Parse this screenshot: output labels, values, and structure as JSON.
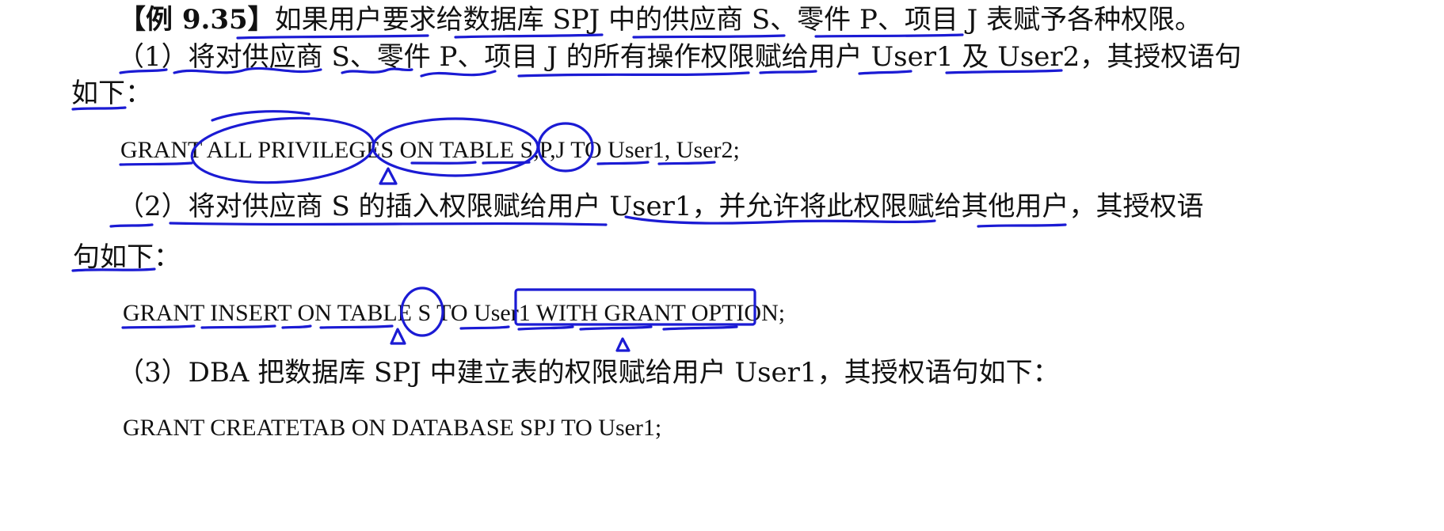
{
  "example": {
    "label": "【例 9.35】",
    "intro": "如果用户要求给数据库 SPJ 中的供应商 S、零件 P、项目 J 表赋予各种权限。"
  },
  "items": [
    {
      "text_line1": "（1）将对供应商 S、零件 P、项目 J 的所有操作权限赋给用户 User1 及 User2，其授权语句",
      "text_line2": "如下：",
      "sql": "GRANT ALL PRIVILEGES ON TABLE S,P,J TO User1, User2;"
    },
    {
      "text_line1": "（2）将对供应商 S 的插入权限赋给用户 User1，并允许将此权限赋给其他用户，其授权语",
      "text_line2": "句如下：",
      "sql": "GRANT INSERT ON TABLE S TO User1 WITH GRANT OPTION;"
    },
    {
      "text_line1": "（3）DBA 把数据库 SPJ 中建立表的权限赋给用户 User1，其授权语句如下：",
      "sql": "GRANT CREATETAB ON DATABASE SPJ TO User1;"
    }
  ],
  "annotation_color": "#1b1bd4"
}
